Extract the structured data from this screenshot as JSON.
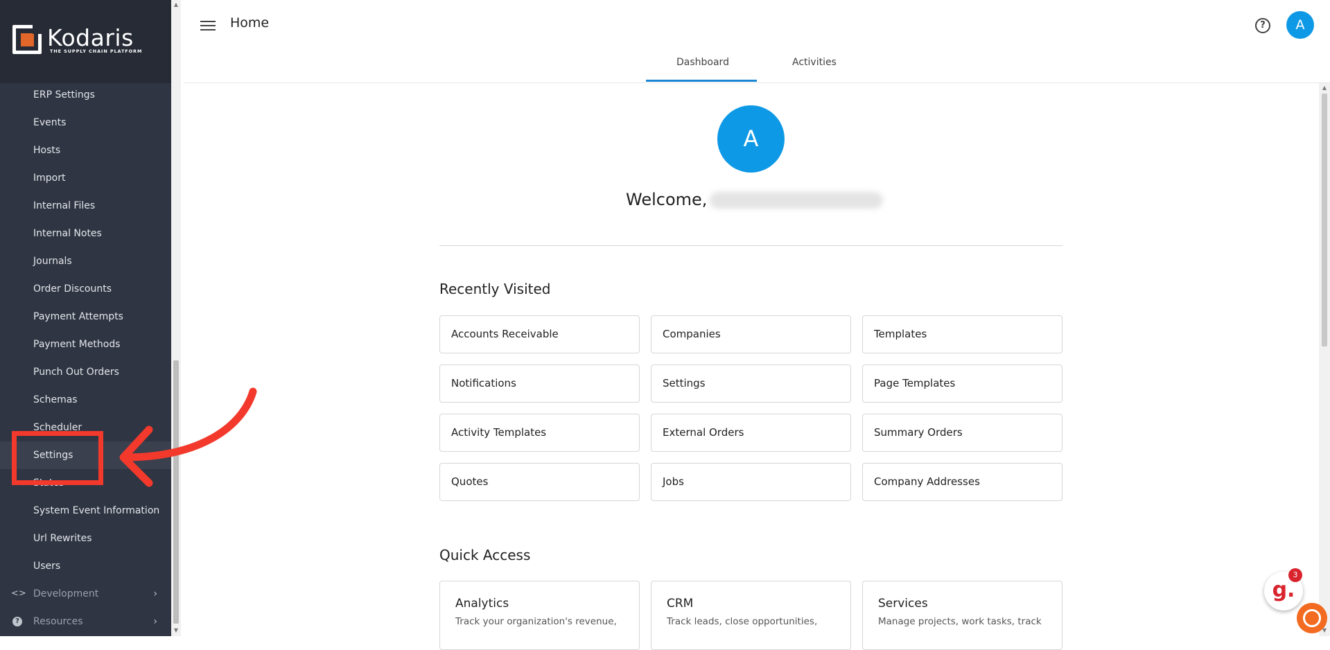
{
  "brand": {
    "name": "Kodaris",
    "tagline": "THE SUPPLY CHAIN PLATFORM",
    "accent": "#e0662a"
  },
  "sidebar": {
    "items": [
      {
        "label": "ERP Settings"
      },
      {
        "label": "Events"
      },
      {
        "label": "Hosts"
      },
      {
        "label": "Import"
      },
      {
        "label": "Internal Files"
      },
      {
        "label": "Internal Notes"
      },
      {
        "label": "Journals"
      },
      {
        "label": "Order Discounts"
      },
      {
        "label": "Payment Attempts"
      },
      {
        "label": "Payment Methods"
      },
      {
        "label": "Punch Out Orders"
      },
      {
        "label": "Schemas"
      },
      {
        "label": "Scheduler"
      },
      {
        "label": "Settings",
        "active": true
      },
      {
        "label": "States"
      },
      {
        "label": "System Event Information"
      },
      {
        "label": "Url Rewrites"
      },
      {
        "label": "Users"
      }
    ],
    "sections": [
      {
        "label": "Development",
        "icon": "code-icon"
      },
      {
        "label": "Resources",
        "icon": "help-circle-icon"
      }
    ]
  },
  "header": {
    "title": "Home",
    "avatar_initial": "A",
    "tabs": [
      {
        "label": "Dashboard",
        "active": true
      },
      {
        "label": "Activities"
      }
    ]
  },
  "welcome": {
    "text": "Welcome,",
    "avatar_initial": "A"
  },
  "recently_visited": {
    "title": "Recently Visited",
    "items": [
      "Accounts Receivable",
      "Companies",
      "Templates",
      "Notifications",
      "Settings",
      "Page Templates",
      "Activity Templates",
      "External Orders",
      "Summary Orders",
      "Quotes",
      "Jobs",
      "Company Addresses"
    ]
  },
  "quick_access": {
    "title": "Quick Access",
    "items": [
      {
        "title": "Analytics",
        "desc": "Track your organization's revenue,"
      },
      {
        "title": "CRM",
        "desc": "Track leads, close opportunities,"
      },
      {
        "title": "Services",
        "desc": "Manage projects, work tasks, track"
      }
    ]
  },
  "widgets": {
    "g_badge": "3"
  },
  "colors": {
    "primary": "#0d99e5",
    "annotation": "#f2392c",
    "sidebar_bg": "#2f3542"
  }
}
